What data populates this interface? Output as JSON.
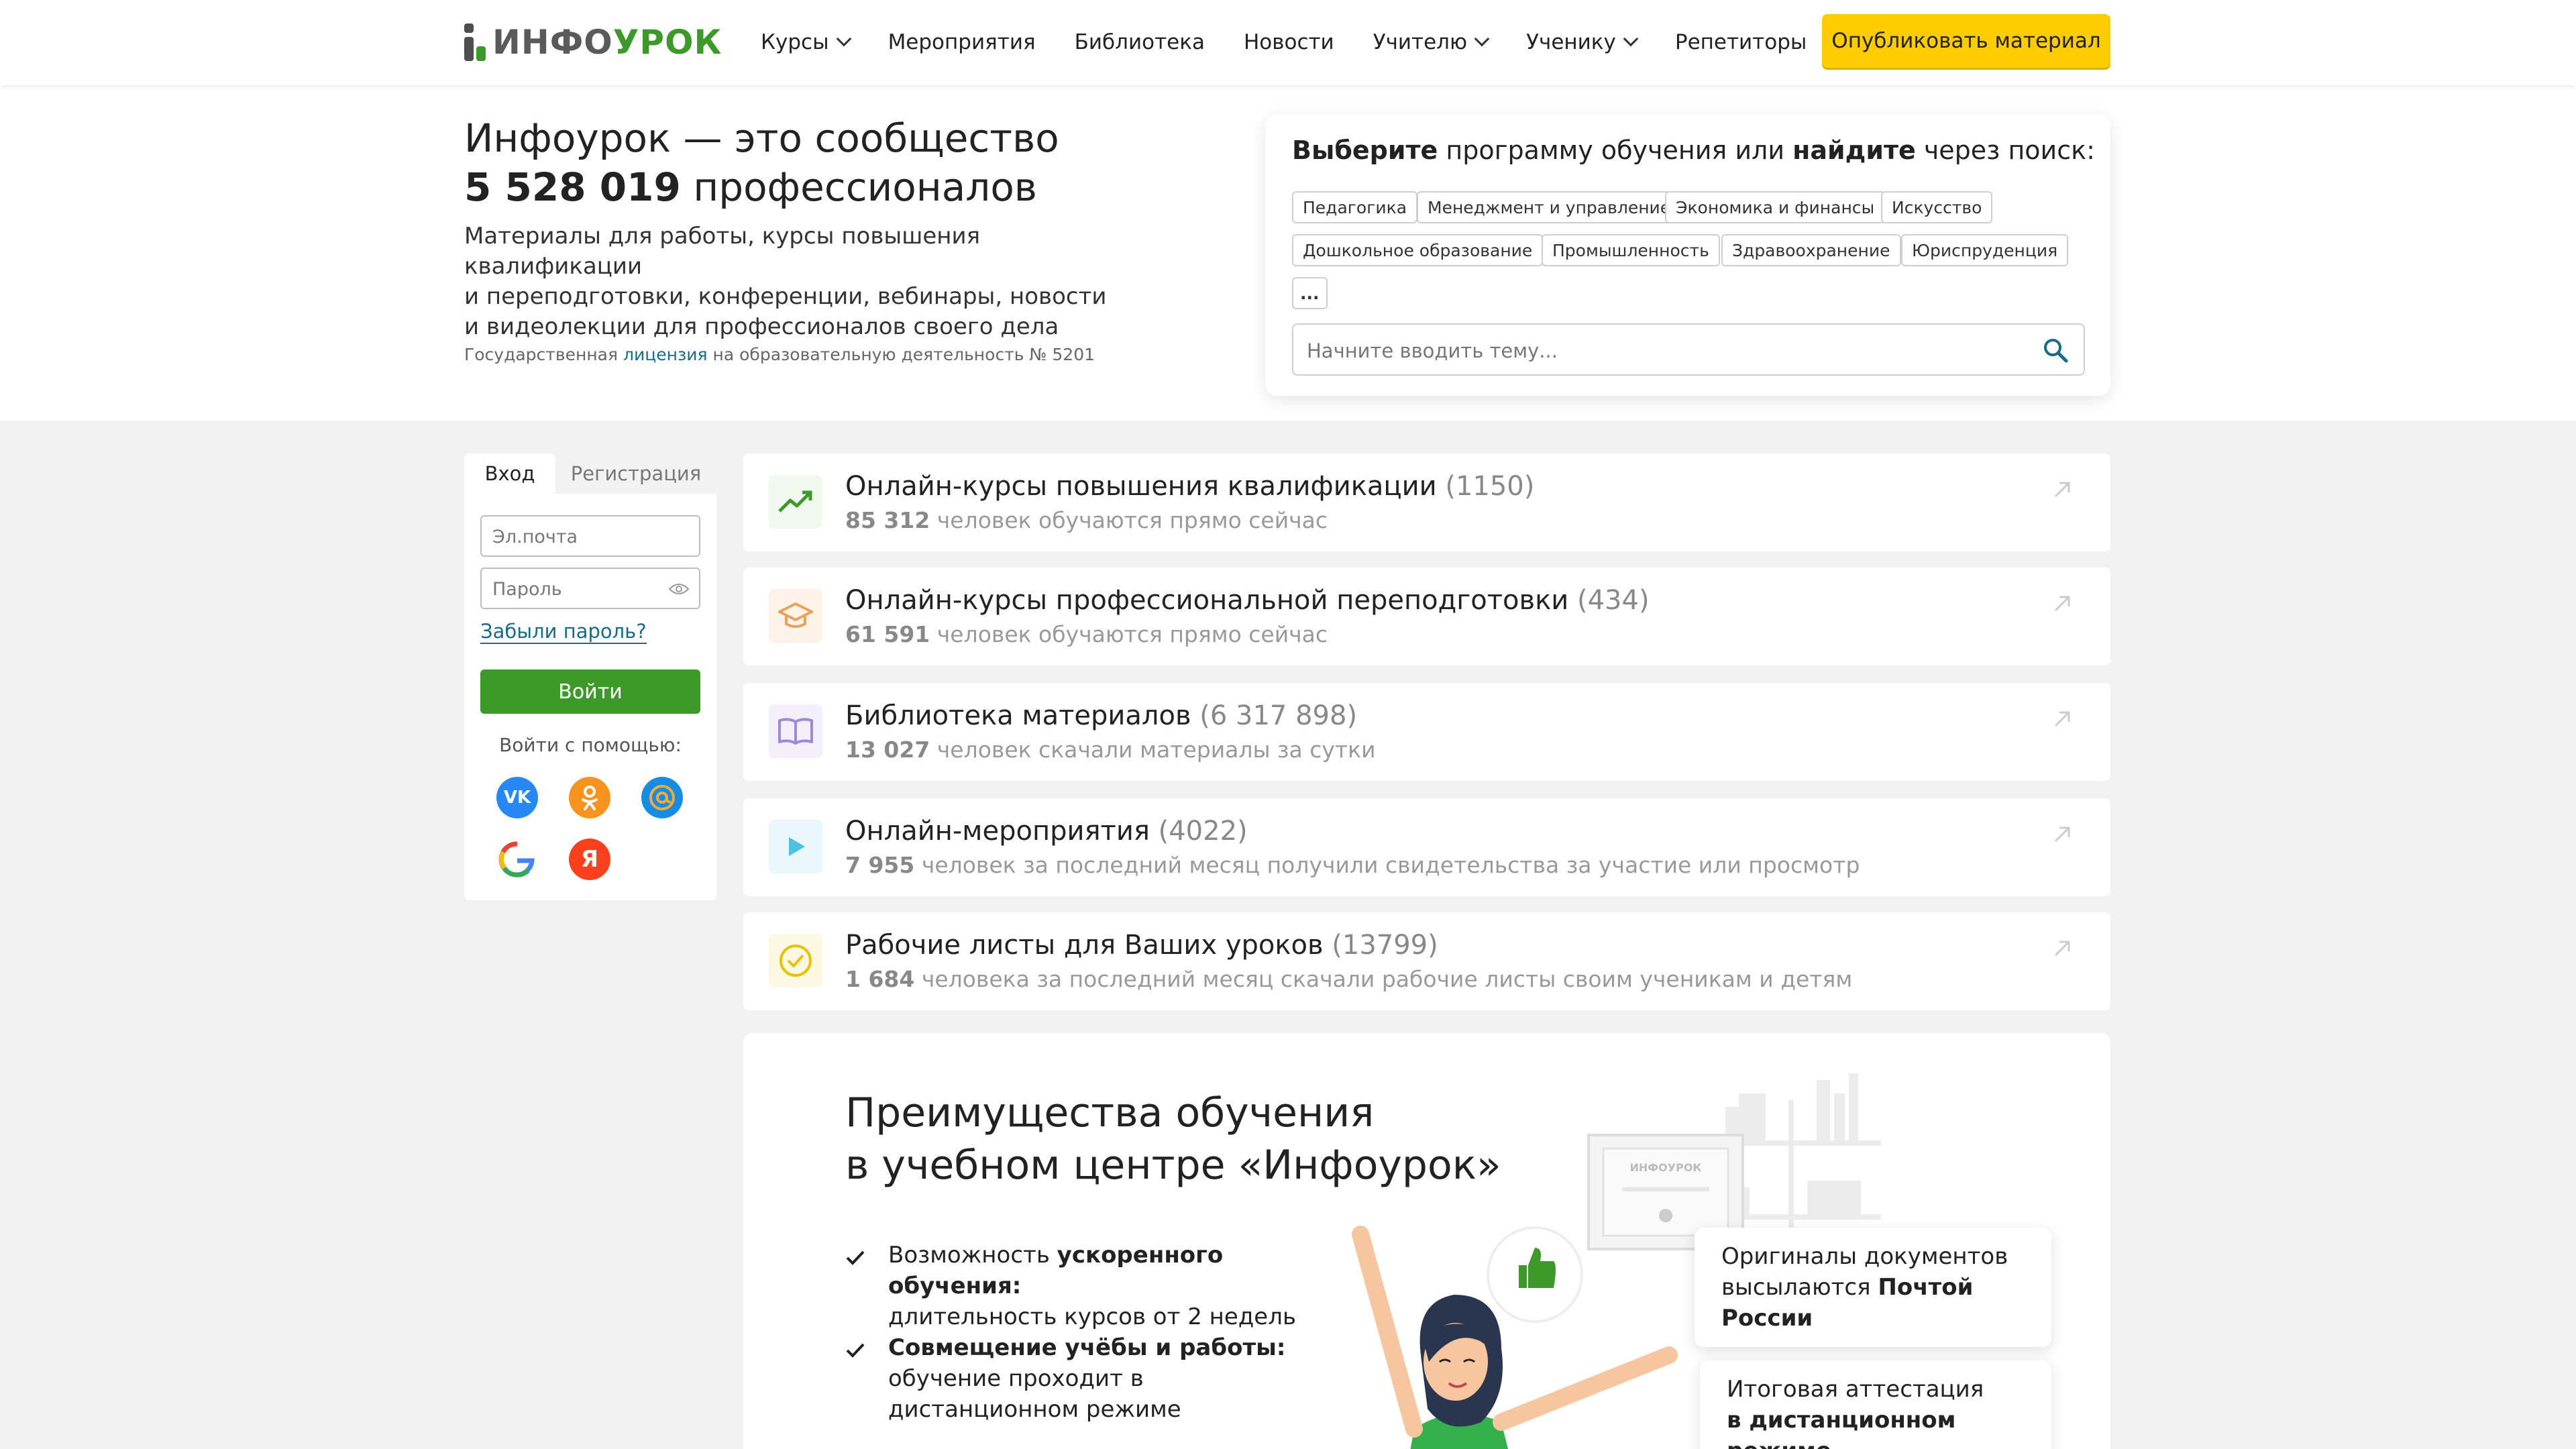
{
  "header": {
    "logo_main": "ИНФО",
    "logo_accent": "УРОК",
    "nav": [
      {
        "label": "Курсы",
        "dropdown": true
      },
      {
        "label": "Мероприятия",
        "dropdown": false
      },
      {
        "label": "Библиотека",
        "dropdown": false
      },
      {
        "label": "Новости",
        "dropdown": false
      },
      {
        "label": "Учителю",
        "dropdown": true
      },
      {
        "label": "Ученику",
        "dropdown": true
      },
      {
        "label": "Репетиторы",
        "dropdown": false
      }
    ],
    "publish_label": "Опубликовать материал"
  },
  "hero": {
    "title_line1": "Инфоурок — это сообщество",
    "title_count": "5 528 019",
    "title_rest": "профессионалов",
    "desc_line1": "Материалы для работы, курсы повышения квалификации",
    "desc_line2": "и переподготовки, конференции, вебинары, новости",
    "desc_line3": "и видеолекции для профессионалов своего дела",
    "license_prefix": "Государственная",
    "license_link": "лицензия",
    "license_suffix": "на образовательную деятельность № 5201"
  },
  "search": {
    "title_b1": "Выберите",
    "title_mid": "программу обучения или",
    "title_b2": "найдите",
    "title_end": "через поиск:",
    "tags": [
      "Педагогика",
      "Менеджмент и управление",
      "Экономика и финансы",
      "Искусство",
      "Дошкольное образование",
      "Промышленность",
      "Здравоохранение",
      "Юриспруденция",
      "..."
    ],
    "placeholder": "Начните вводить тему..."
  },
  "login": {
    "tab_login": "Вход",
    "tab_register": "Регистрация",
    "email_placeholder": "Эл.почта",
    "password_placeholder": "Пароль",
    "forgot": "Забыли пароль?",
    "submit": "Войти",
    "social_label": "Войти с помощью:",
    "social": [
      "vk",
      "ok",
      "mail",
      "google",
      "yandex"
    ]
  },
  "sections": [
    {
      "title": "Онлайн-курсы повышения квалификации",
      "count": "(1150)",
      "num": "85 312",
      "text": "человек обучаются прямо сейчас",
      "icon": "trending-up-icon",
      "color": "#3d9a2a"
    },
    {
      "title": "Онлайн-курсы профессиональной переподготовки",
      "count": "(434)",
      "num": "61 591",
      "text": "человек обучаются прямо сейчас",
      "icon": "graduation-cap-icon",
      "color": "#e8a15a"
    },
    {
      "title": "Библиотека материалов",
      "count": "(6 317 898)",
      "num": "13 027",
      "text": "человек скачали материалы за сутки",
      "icon": "book-icon",
      "color": "#9b8ad6"
    },
    {
      "title": "Онлайн-мероприятия",
      "count": "(4022)",
      "num": "7 955",
      "text": "человек за последний месяц получили свидетельства за участие или просмотр",
      "icon": "play-icon",
      "color": "#4ec0e0"
    },
    {
      "title": "Рабочие листы для Ваших уроков",
      "count": "(13799)",
      "num": "1 684",
      "text": "человека за последний месяц скачали рабочие листы своим ученикам и детям",
      "icon": "check-circle-icon",
      "color": "#e6c200"
    }
  ],
  "advantages": {
    "title_line1": "Преимущества обучения",
    "title_line2": "в учебном центре «Инфоурок»",
    "items": [
      {
        "pre": "Возможность",
        "bold": "ускоренного обучения:",
        "rest": "длительность курсов от 2 недель"
      },
      {
        "pre": "",
        "bold": "Совмещение учёбы и работы:",
        "rest": "обучение проходит в дистанционном режиме"
      }
    ],
    "bubble1_pre": "Оригиналы документов",
    "bubble1_mid": "высылаются",
    "bubble1_bold": "Почтой России",
    "bubble2_pre": "Итоговая аттестация",
    "bubble2_bold": "в дистанционном режиме",
    "diploma_logo": "ИНФОУРОК"
  },
  "colors": {
    "brand_green": "#3d9a2a",
    "accent_yellow": "#ffcc00",
    "link": "#1a6a8a"
  }
}
